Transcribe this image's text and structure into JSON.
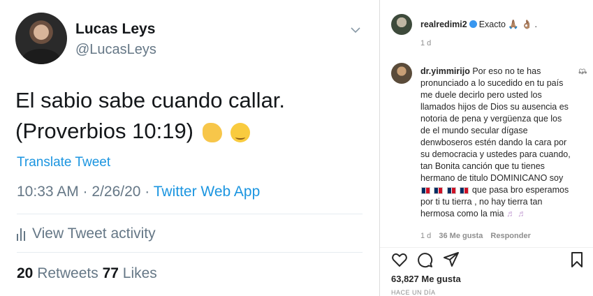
{
  "tweet": {
    "name": "Lucas Leys",
    "handle": "@LucasLeys",
    "text_line1": "El sabio sabe cuando callar.",
    "text_line2": "(Proverbios 10:19)",
    "translate": "Translate Tweet",
    "time_date": "10:33 AM · 2/26/20 · ",
    "app": "Twitter Web App",
    "activity": "View Tweet activity",
    "retweets_count": "20",
    "retweets_label": " Retweets  ",
    "likes_count": "77",
    "likes_label": " Likes"
  },
  "instagram": {
    "post_user": "realredimi2",
    "post_caption": "Exacto 🙏🏽 👌🏽 .",
    "post_age": "1 d",
    "comment": {
      "user": "dr.yimmirijo",
      "text": "Por eso no te has pronunciado a lo sucedido en tu país me duele decirlo pero usted los llamados hijos de Dios su ausencia es notoria de pena y vergüenza que los de el mundo secular dígase denwboseros estén dando la cara por su democracia y ustedes para cuando, tan Bonita canción que tu tienes hermano de titulo DOMINICANO soy",
      "tail": " que pasa bro esperamos por ti tu tierra , no hay tierra tan hermosa como la mia",
      "age": "1 d",
      "likes": "36 Me gusta",
      "reply": "Responder"
    },
    "likes_total": "63,827 Me gusta",
    "posted": "HACE UN DÍA"
  },
  "colors": {
    "twitter_blue": "#1b95e0",
    "gray": "#657786",
    "ig_verified": "#3897f0"
  }
}
